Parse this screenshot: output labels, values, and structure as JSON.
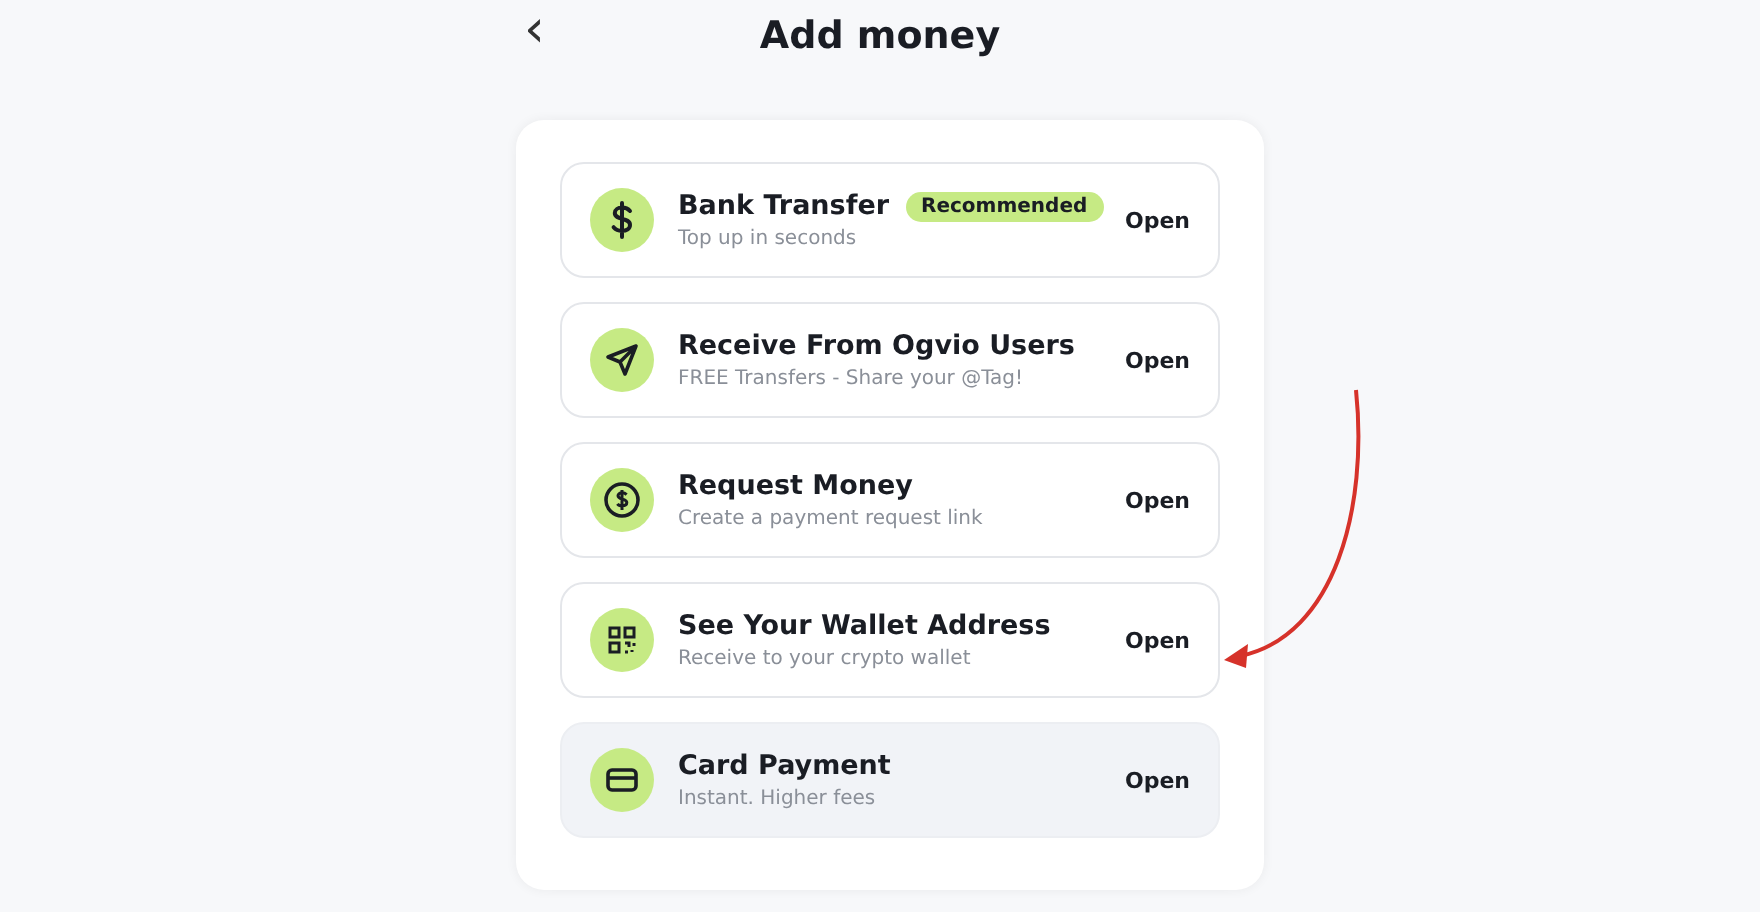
{
  "header": {
    "back": "‹",
    "title": "Add money"
  },
  "options": [
    {
      "title": "Bank Transfer",
      "badge": "Recommended",
      "subtitle": "Top up in seconds",
      "action": "Open",
      "highlighted": false
    },
    {
      "title": "Receive From Ogvio Users",
      "subtitle": "FREE Transfers - Share your @Tag!",
      "action": "Open",
      "highlighted": false
    },
    {
      "title": "Request Money",
      "subtitle": "Create a payment request link",
      "action": "Open",
      "highlighted": false
    },
    {
      "title": "See Your Wallet Address",
      "subtitle": "Receive to your crypto wallet",
      "action": "Open",
      "highlighted": false
    },
    {
      "title": "Card Payment",
      "subtitle": "Instant. Higher fees",
      "action": "Open",
      "highlighted": true
    }
  ],
  "annotation": {
    "kind": "arrow"
  }
}
